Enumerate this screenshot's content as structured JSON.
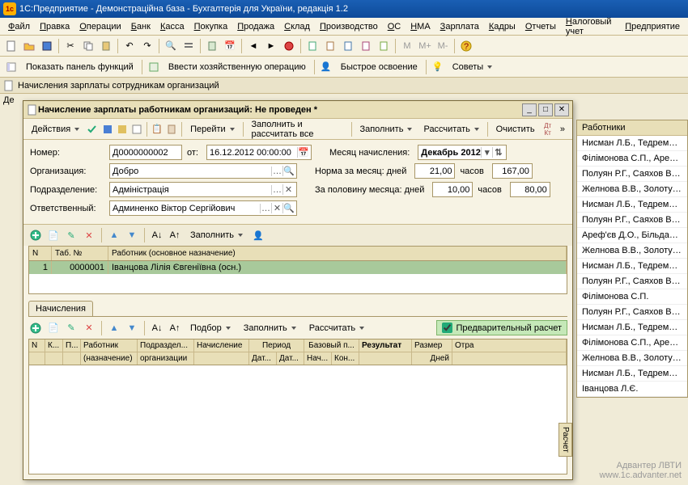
{
  "app_title": "1С:Предприятие - Демонстраційна база - Бухгалтерія для України, редакція 1.2",
  "menu": [
    "Файл",
    "Правка",
    "Операции",
    "Банк",
    "Касса",
    "Покупка",
    "Продажа",
    "Склад",
    "Производство",
    "ОС",
    "НМА",
    "Зарплата",
    "Кадры",
    "Отчеты",
    "Налоговый учет",
    "Предприятие"
  ],
  "toolbar2": {
    "show_panel": "Показать панель функций",
    "enter_op": "Ввести хозяйственную операцию",
    "fast": "Быстрое освоение",
    "tips": "Советы"
  },
  "list_title": "Начисления зарплаты сотрудникам организаций",
  "row_prefix": "Де",
  "dialog": {
    "title": "Начисление зарплаты работникам организаций: Не проведен *",
    "actions": "Действия",
    "goto": "Перейти",
    "fill_calc_all": "Заполнить и рассчитать все",
    "fill": "Заполнить",
    "calc": "Рассчитать",
    "clear": "Очистить",
    "form": {
      "number_lbl": "Номер:",
      "number": "Д0000000002",
      "from_lbl": "от:",
      "date": "16.12.2012 00:00:00",
      "month_lbl": "Месяц начисления:",
      "month": "Декабрь 2012",
      "org_lbl": "Организация:",
      "org": "Добро",
      "norm_lbl": "Норма за месяц: дней",
      "norm_days": "21,00",
      "hours_lbl": "часов",
      "norm_hours": "167,00",
      "dept_lbl": "Подразделение:",
      "dept": "Адміністрація",
      "half_lbl": "За половину месяца: дней",
      "half_days": "10,00",
      "half_hours": "80,00",
      "resp_lbl": "Ответственный:",
      "resp": "Админенко Віктор Сергійович"
    },
    "grid1": {
      "fill": "Заполнить",
      "cols": {
        "n": "N",
        "tab": "Таб. №",
        "emp": "Работник (основное назначение)"
      },
      "row": {
        "n": "1",
        "tab": "0000001",
        "emp": "Іванцова Лілія Євгеніївна (осн.)"
      }
    },
    "tab": "Начисления",
    "detail": {
      "pick": "Подбор",
      "fill": "Заполнить",
      "calc": "Рассчитать",
      "prelim": "Предварительный расчет",
      "side": "Расчет",
      "cols": {
        "n": "N",
        "k": "К...",
        "p": "П...",
        "emp": "Работник",
        "emp2": "(назначение)",
        "dept": "Подраздел...",
        "dept2": "организации",
        "acc": "Начисление",
        "period": "Период",
        "dat1": "Дат...",
        "dat2": "Дат...",
        "base": "Базовый п...",
        "b1": "Нач...",
        "b2": "Кон...",
        "result": "Результат",
        "size": "Размер",
        "days": "Дней",
        "dep": "Отра"
      }
    }
  },
  "sidebar": {
    "title": "Работники",
    "items": [
      "Нисман Л.Б., Тедремаа Т.",
      "Філімонова С.П., Ареф'єв",
      "Полуян Р.Г., Саяхов В.В.,",
      "Желнова В.В., Золотухін О",
      "Нисман Л.Б., Тедремаа Т.",
      "Полуян Р.Г., Саяхов В.В.,",
      "Ареф'єв Д.О., Більданов О",
      "Желнова В.В., Золотухін О",
      "Нисман Л.Б., Тедремаа Т.",
      "Полуян Р.Г., Саяхов В.В.,",
      "Філімонова С.П.",
      "Полуян Р.Г., Саяхов В.В.,",
      "Нисман Л.Б., Тедремаа Т.",
      "Філімонова С.П., Ареф'єв",
      "Желнова В.В., Золотухін О",
      "Нисман Л.Б., Тедремаа Т.",
      "Іванцова Л.Є."
    ]
  },
  "watermark": {
    "l1": "Адвантер ЛВТИ",
    "l2": "www.1c.advanter.net"
  }
}
